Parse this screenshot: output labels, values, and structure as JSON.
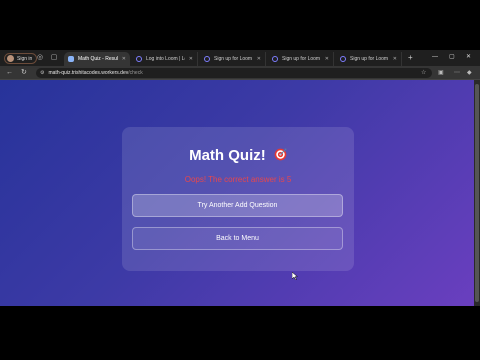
{
  "profile": {
    "label": "Sign in"
  },
  "tabs": [
    {
      "label": "Math Quiz - Result",
      "active": true
    },
    {
      "label": "Log into Loom | Loom",
      "active": false
    },
    {
      "label": "Sign up for Loom | Loom",
      "active": false
    },
    {
      "label": "Sign up for Loom | Loom",
      "active": false
    },
    {
      "label": "Sign up for Loom | Loom",
      "active": false
    }
  ],
  "address": {
    "host": "math-quiz.trishitacodes.workers.dev",
    "path": "/check"
  },
  "quiz": {
    "title": "Math Quiz!",
    "feedback": "Oops! The correct answer is 5",
    "try_again_label": "Try Another Add Question",
    "back_label": "Back to Menu"
  },
  "colors": {
    "feedback": "#e8474c",
    "gradient_start": "#27339a",
    "gradient_end": "#6a3fbf"
  },
  "icons": {
    "title_emoji": "direct-hit-target-icon"
  }
}
